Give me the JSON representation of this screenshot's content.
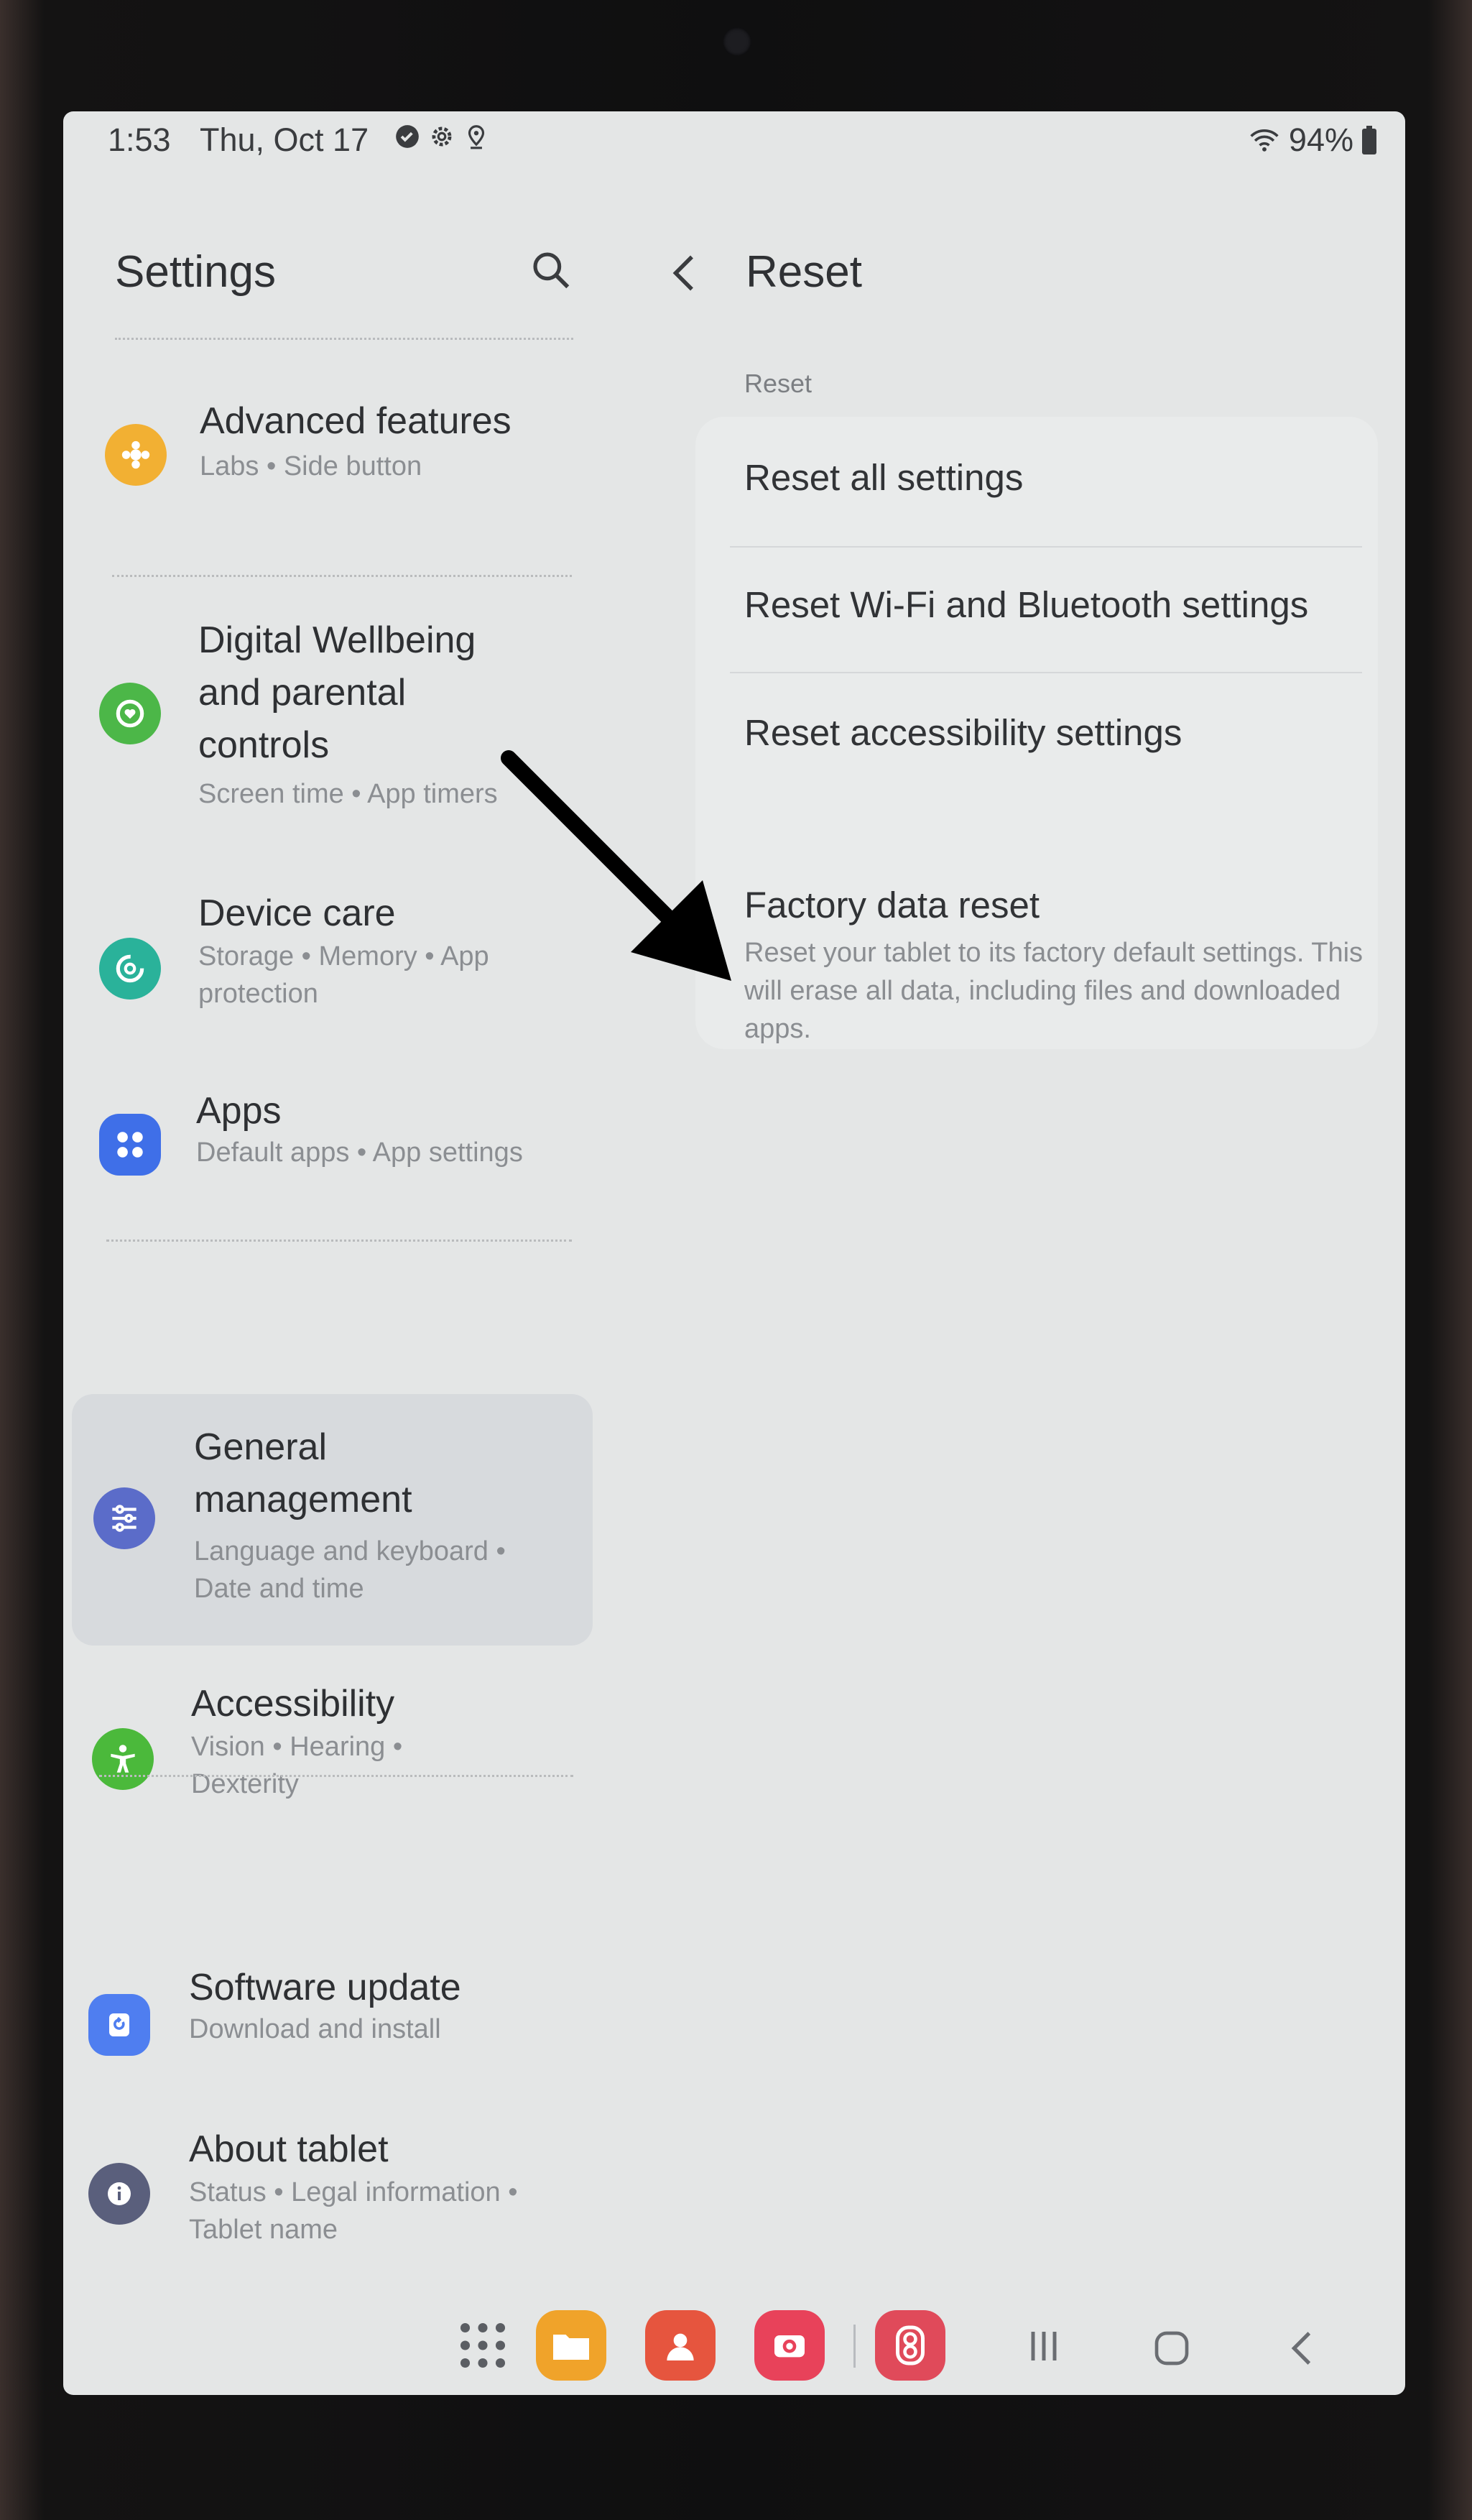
{
  "status_bar": {
    "time": "1:53",
    "date": "Thu, Oct 17",
    "battery": "94%",
    "icons": [
      "check-badge-icon",
      "gear-icon",
      "location-icon",
      "wifi-icon",
      "battery-icon"
    ]
  },
  "left_panel": {
    "title": "Settings",
    "items": [
      {
        "title": "Advanced features",
        "subtitle": "Labs  •  Side button",
        "icon": "advanced-features-icon",
        "color": "#f2b033"
      },
      {
        "title": "Digital Wellbeing\nand parental\ncontrols",
        "subtitle": "Screen time  •  App timers",
        "icon": "digital-wellbeing-icon",
        "color": "#4cb748"
      },
      {
        "title": "Device care",
        "subtitle": "Storage  •  Memory  •  App\nprotection",
        "icon": "device-care-icon",
        "color": "#2ab29a"
      },
      {
        "title": "Apps",
        "subtitle": "Default apps  •  App settings",
        "icon": "apps-icon",
        "color": "#3f6fe8"
      },
      {
        "title": "General\nmanagement",
        "subtitle": "Language and keyboard  •\nDate and time",
        "icon": "general-management-icon",
        "color": "#5b6cc9"
      },
      {
        "title": "Accessibility",
        "subtitle": "Vision  •  Hearing  •\nDexterity",
        "icon": "accessibility-icon",
        "color": "#4bb93b"
      },
      {
        "title": "Software update",
        "subtitle": "Download and install",
        "icon": "software-update-icon",
        "color": "#4f7ef0"
      },
      {
        "title": "About tablet",
        "subtitle": "Status  •  Legal information  •\nTablet name",
        "icon": "about-tablet-icon",
        "color": "#5a5f7c"
      }
    ]
  },
  "right_panel": {
    "title": "Reset",
    "section_label": "Reset",
    "options": [
      {
        "title": "Reset all settings"
      },
      {
        "title": "Reset Wi-Fi and Bluetooth settings"
      },
      {
        "title": "Reset accessibility settings"
      }
    ],
    "factory": {
      "title": "Factory data reset",
      "description": "Reset your tablet to its factory default settings. This will erase all data, including files and downloaded apps."
    }
  },
  "dock": {
    "apps": [
      {
        "name": "app-drawer-icon"
      },
      {
        "name": "my-files-icon",
        "color": "#f0a32a"
      },
      {
        "name": "contacts-icon",
        "color": "#e6553e"
      },
      {
        "name": "camera-icon",
        "color": "#e8425a"
      },
      {
        "name": "multi-window-icon",
        "color": "#e04a5a"
      }
    ],
    "nav": [
      "recents-icon",
      "home-icon",
      "back-icon"
    ]
  }
}
